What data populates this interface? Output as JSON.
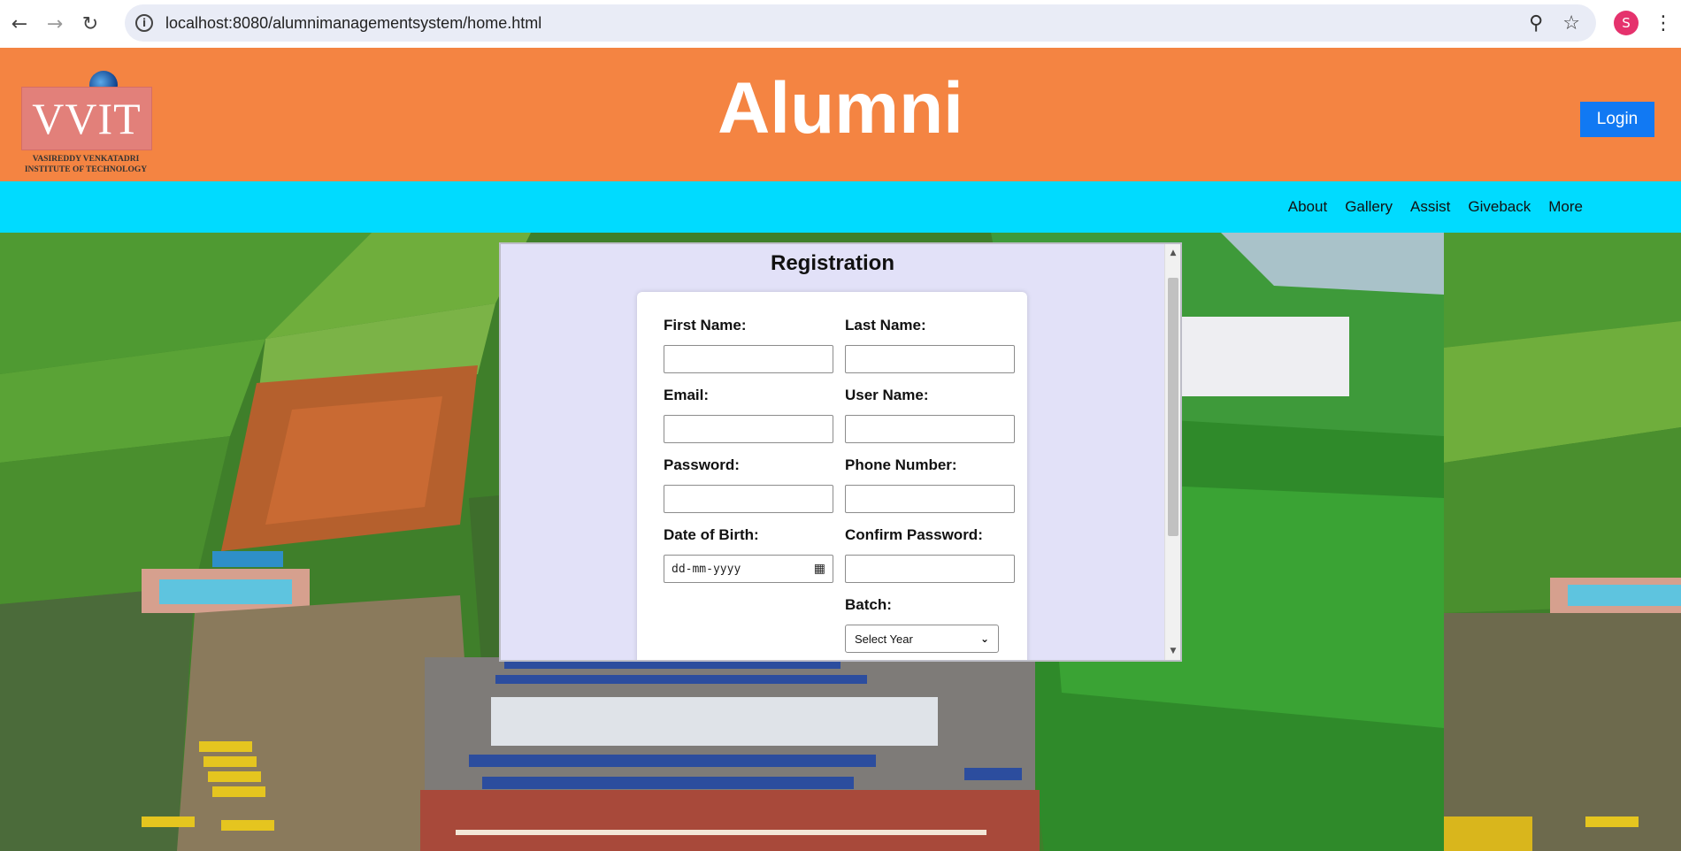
{
  "browser": {
    "url": "localhost:8080/alumnimanagementsystem/home.html",
    "profile_initial": "S",
    "icons": [
      "back-arrow-icon",
      "forward-arrow-icon",
      "reload-icon",
      "site-info-icon",
      "zoom-icon",
      "bookmark-star-icon",
      "more-menu-icon"
    ]
  },
  "header": {
    "logo_text": "VVIT",
    "logo_subtitle_line1": "VASIREDDY VENKATADRI",
    "logo_subtitle_line2": "INSTITUTE OF TECHNOLOGY",
    "title": "Alumni",
    "login_label": "Login",
    "colors": {
      "header_bg": "#f48442",
      "nav_bg": "#00dbff",
      "login_bg": "#1179f3"
    }
  },
  "nav": {
    "items": [
      {
        "label": "About"
      },
      {
        "label": "Gallery"
      },
      {
        "label": "Assist"
      },
      {
        "label": "Giveback"
      },
      {
        "label": "More"
      }
    ]
  },
  "registration": {
    "title": "Registration",
    "first_name_label": "First Name:",
    "last_name_label": "Last Name:",
    "email_label": "Email:",
    "user_name_label": "User Name:",
    "password_label": "Password:",
    "phone_label": "Phone Number:",
    "dob_label": "Date of Birth:",
    "dob_placeholder": "dd-mm-yyyy",
    "confirm_password_label": "Confirm Password:",
    "batch_label": "Batch:",
    "batch_selected": "Select Year"
  }
}
